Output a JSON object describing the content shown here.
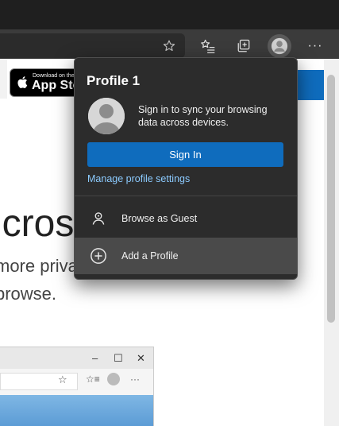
{
  "browser": {
    "toolbar_icons": [
      "favorites-star-icon",
      "favorites-list-icon",
      "collections-icon",
      "profile-avatar-icon",
      "more-menu-icon"
    ],
    "more_label": "···"
  },
  "page": {
    "appstore_small": "Download on the",
    "appstore_big": "App Store",
    "heading": "Microsoft",
    "subtitle_line1": "more private",
    "subtitle_line2": "browse."
  },
  "mini_window": {
    "minimize": "–",
    "maximize": "☐",
    "close": "✕",
    "more": "···"
  },
  "profile_menu": {
    "title": "Profile 1",
    "message": "Sign in to sync your browsing data across devices.",
    "sign_in_label": "Sign In",
    "manage_link": "Manage profile settings",
    "items": [
      {
        "label": "Browse as Guest",
        "icon": "guest-icon"
      },
      {
        "label": "Add a Profile",
        "icon": "add-profile-icon"
      }
    ]
  },
  "colors": {
    "accent": "#0f6cbd",
    "link": "#8ccbff",
    "flyout_bg": "#2c2c2c",
    "hover_row": "#4a4a4a"
  }
}
